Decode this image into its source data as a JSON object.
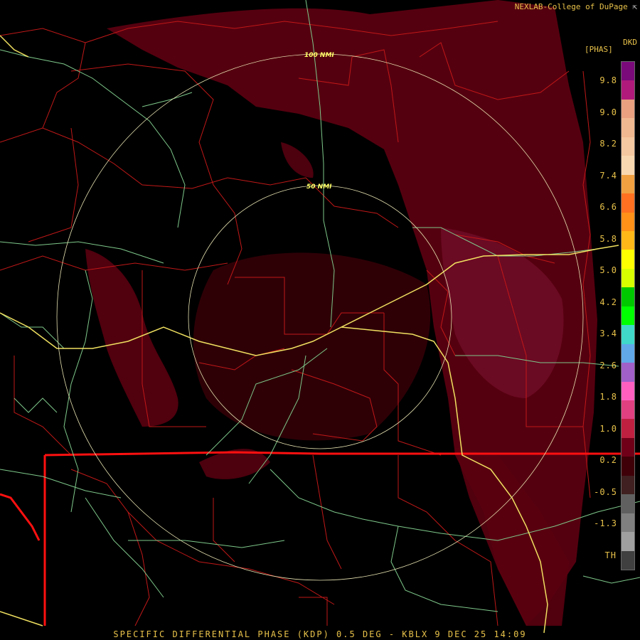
{
  "header": {
    "credit": "NEXLAB-College of DuPage",
    "credit_mark": "⇱",
    "product_code": "DKD",
    "unit": "[PHAS]"
  },
  "ring_labels": {
    "outer": "100 NMI",
    "inner": "50 NMI"
  },
  "legend": {
    "ticks": [
      "9.8",
      "9.0",
      "8.2",
      "7.4",
      "6.6",
      "5.8",
      "5.0",
      "4.2",
      "3.4",
      "2.6",
      "1.8",
      "1.0",
      "0.2",
      "-0.5",
      "-1.3",
      "TH"
    ],
    "colors": [
      "#7a0a7a",
      "#b01a7a",
      "#e8a080",
      "#f0b890",
      "#f4c8a0",
      "#f8d8b0",
      "#f0a040",
      "#ff7020",
      "#ff9018",
      "#ffb818",
      "#ffff00",
      "#d8ff00",
      "#00c800",
      "#00ff00",
      "#40d8c8",
      "#60a8e8",
      "#a060c8",
      "#ff60c0",
      "#e04080",
      "#c02040",
      "#700018",
      "#400008",
      "#402020",
      "#606060",
      "#808080",
      "#a0a0a0",
      "#404040"
    ]
  },
  "footer": {
    "text": "SPECIFIC DIFFERENTIAL PHASE (KDP) 0.5 DEG - KBLX 9 DEC 25 14:09"
  }
}
